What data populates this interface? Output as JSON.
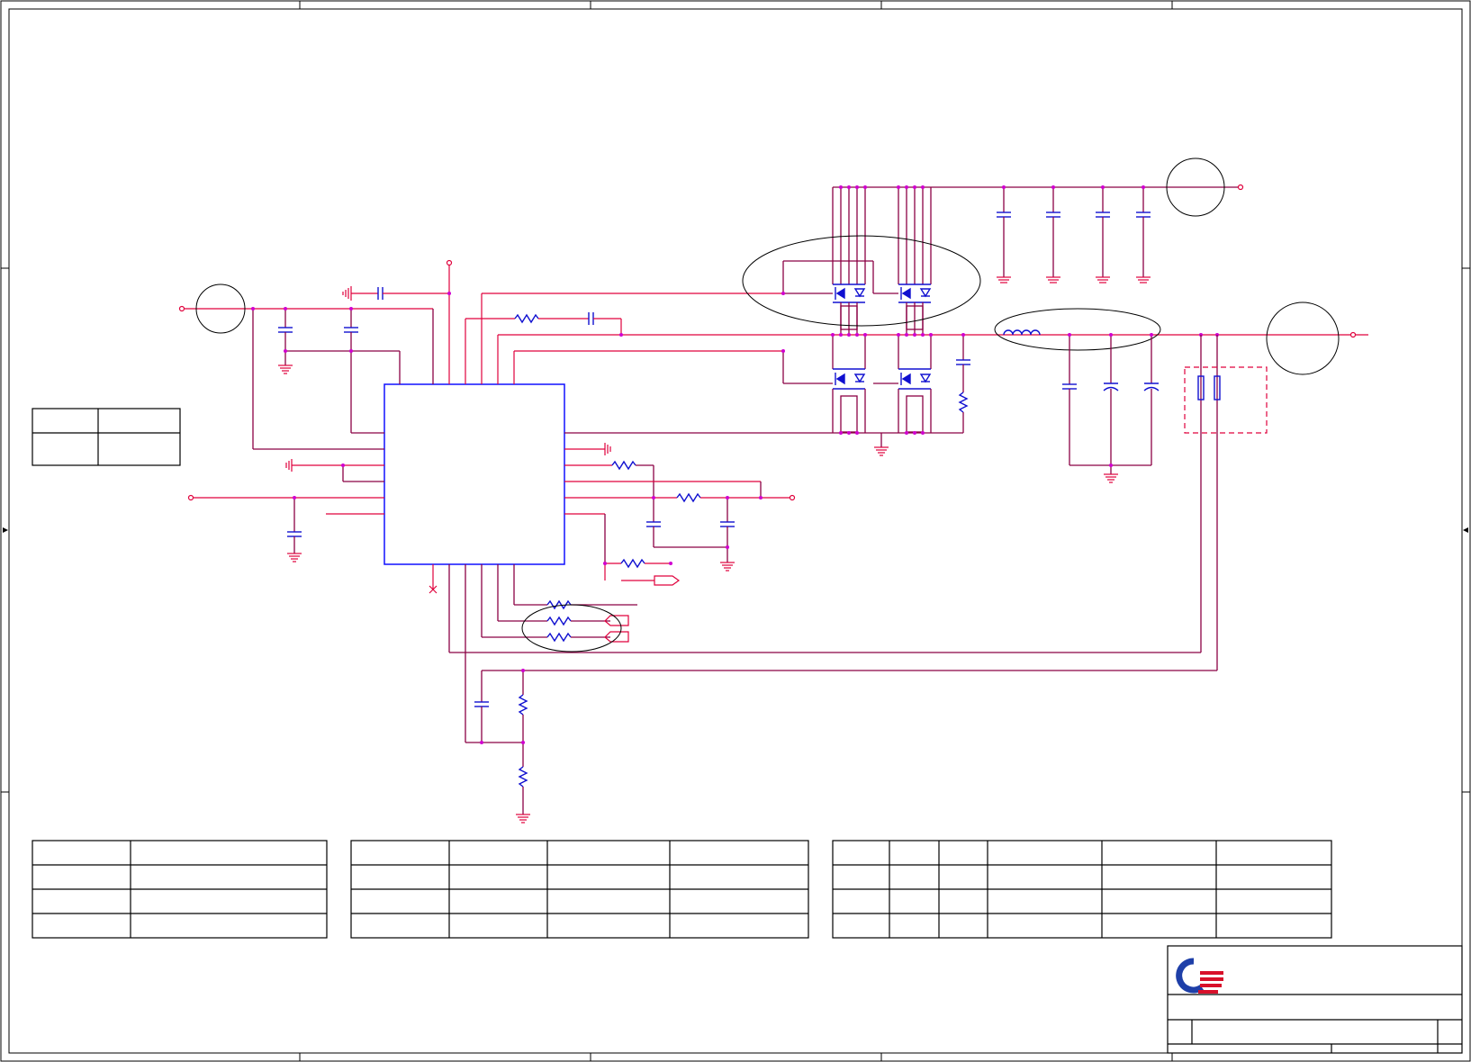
{
  "sheet": {
    "background": "#ffffff",
    "colors": {
      "wire": "#8b0044",
      "net": "#e0003c",
      "component": "#1010d0",
      "junction": "#d000d0",
      "frame": "#000000",
      "logo_blue": "#1e3fa8",
      "logo_red": "#d8102a"
    },
    "title_block": {
      "logo": "company-logo",
      "title": "",
      "size": "",
      "document_number": "",
      "revision": "",
      "date": "",
      "sheet": ""
    }
  },
  "icons": [
    "ground-icon",
    "capacitor-icon",
    "resistor-icon",
    "inductor-icon",
    "mosfet-icon",
    "company-logo"
  ]
}
